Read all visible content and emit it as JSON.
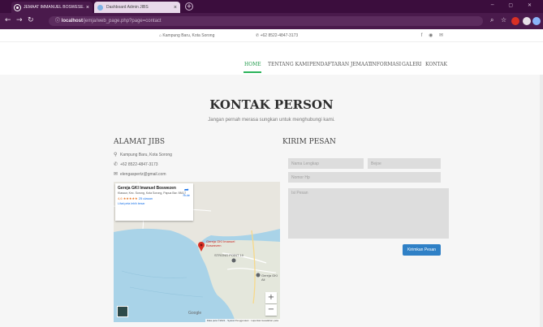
{
  "browser": {
    "tabs": [
      {
        "title": "JEMAAT IMMANUEL BOSWESE...",
        "active": true
      },
      {
        "title": "Dashboard Admin JIBS",
        "active": false
      }
    ],
    "url_host": "localhost",
    "url_path": "/jemja/web_page.php?page=contact"
  },
  "topbar": {
    "address": "Kampung Baru, Kota Sorong",
    "phone": "+62 8522-4847-3173",
    "social": "f ◉ ✉"
  },
  "nav": {
    "items": [
      "HOME",
      "TENTANG KAMI",
      "PENDAFTARAN JEMAAT",
      "INFORMASI",
      "GALERI",
      "KONTAK"
    ],
    "active": "HOME"
  },
  "page": {
    "title": "KONTAK PERSON",
    "subtitle": "Jangan pernah merasa sungkan untuk menghubungi kami."
  },
  "address_section": {
    "title": "ALAMAT JIBS",
    "address": "Kampung Baru, Kota Sorong",
    "phone": "+62 8522-4847-3173",
    "email": "elengaspertz@gmail.com"
  },
  "map": {
    "place_name": "Gereja GKI Imanuel Boswezen",
    "place_address": "Klasaur, Kec. Sorong, Kota Sorong, Papua Bar. 98417",
    "rating": "4,6",
    "stars": "★★★★★",
    "review_count": "25 ulasan",
    "larger_map": "Lihat peta lebih besar",
    "directions": "Rute",
    "pin_label": "Gereja GKI Imanuel Boswezen",
    "landmark": "STRONG POINT 10",
    "second_label": "Gereja GKI Ali",
    "logo": "Google",
    "attribution": "Data peta ©2021 · Syarat Penggunaan · Laporkan kesalahan peta",
    "zoom_in": "+",
    "zoom_out": "−"
  },
  "form": {
    "title": "KIRIM PESAN",
    "name_placeholder": "Nama Lengkap",
    "subject_placeholder": "Bejoe",
    "phone_placeholder": "Nomor Hp",
    "message_placeholder": "Isi Pesan",
    "submit_label": "Kirimkan Pesan"
  },
  "colors": {
    "browser_frame": "#4a1a4c",
    "nav_active": "#1f9a4a",
    "button": "#2f80c6",
    "page_bg": "#f6f6f6"
  }
}
